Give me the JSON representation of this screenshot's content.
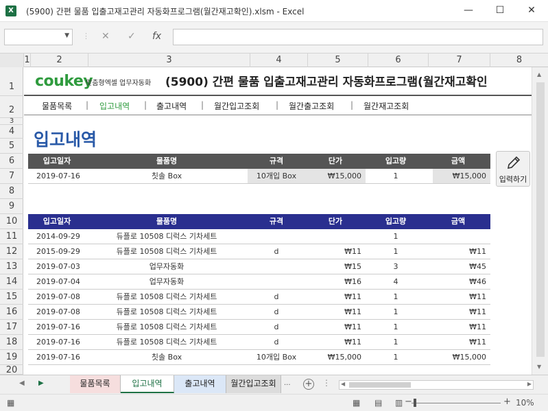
{
  "window": {
    "title": "(5900) 간편 물품 입출고재고관리 자동화프로그램(월간재고확인).xlsm - Excel",
    "app_icon": "X",
    "minimize": "—",
    "maximize": "☐",
    "close": "✕"
  },
  "formula_bar": {
    "cancel": "✕",
    "confirm": "✓",
    "fx": "fx"
  },
  "columns": [
    "1",
    "2",
    "3",
    "4",
    "5",
    "6",
    "7",
    "8"
  ],
  "rows": [
    "1",
    "2",
    "3",
    "4",
    "5",
    "6",
    "7",
    "8",
    "9",
    "10",
    "11",
    "12",
    "13",
    "14",
    "15",
    "16",
    "17",
    "18",
    "19",
    "20"
  ],
  "header": {
    "logo": "coukey",
    "logo_sub": "맞춤형엑셀 업무자동화",
    "title": "(5900) 간편 물품 입출고재고관리 자동화프로그램(월간재고확인"
  },
  "nav": [
    {
      "label": "물품목록",
      "active": false
    },
    {
      "label": "입고내역",
      "active": true
    },
    {
      "label": "출고내역",
      "active": false
    },
    {
      "label": "월간입고조회",
      "active": false
    },
    {
      "label": "월간출고조회",
      "active": false
    },
    {
      "label": "월간재고조회",
      "active": false
    }
  ],
  "nav_separator": "|",
  "section_title": "입고내역",
  "columns_table": [
    "입고일자",
    "물품명",
    "규격",
    "단가",
    "입고량",
    "금액"
  ],
  "entry_row": {
    "date": "2019-07-16",
    "name": "칫솔 Box",
    "spec": "10개입 Box",
    "price": "₩15,000",
    "qty": "1",
    "amount": "₩15,000"
  },
  "input_button": {
    "label": "입력하기",
    "icon": "pencil-icon"
  },
  "list_rows": [
    {
      "date": "2014-09-29",
      "name": "듀플로 10508 디럭스 기차세트",
      "spec": "",
      "price": "",
      "qty": "1",
      "amount": ""
    },
    {
      "date": "2015-09-29",
      "name": "듀플로 10508 디럭스 기차세트",
      "spec": "d",
      "price": "₩11",
      "qty": "1",
      "amount": "₩11"
    },
    {
      "date": "2019-07-03",
      "name": "업무자동화",
      "spec": "",
      "price": "₩15",
      "qty": "3",
      "amount": "₩45"
    },
    {
      "date": "2019-07-04",
      "name": "업무자동화",
      "spec": "",
      "price": "₩16",
      "qty": "4",
      "amount": "₩46"
    },
    {
      "date": "2019-07-08",
      "name": "듀플로 10508 디럭스 기차세트",
      "spec": "d",
      "price": "₩11",
      "qty": "1",
      "amount": "₩11"
    },
    {
      "date": "2019-07-08",
      "name": "듀플로 10508 디럭스 기차세트",
      "spec": "d",
      "price": "₩11",
      "qty": "1",
      "amount": "₩11"
    },
    {
      "date": "2019-07-16",
      "name": "듀플로 10508 디럭스 기차세트",
      "spec": "d",
      "price": "₩11",
      "qty": "1",
      "amount": "₩11"
    },
    {
      "date": "2019-07-16",
      "name": "듀플로 10508 디럭스 기차세트",
      "spec": "d",
      "price": "₩11",
      "qty": "1",
      "amount": "₩11"
    },
    {
      "date": "2019-07-16",
      "name": "칫솔 Box",
      "spec": "10개입 Box",
      "price": "₩15,000",
      "qty": "1",
      "amount": "₩15,000"
    }
  ],
  "sheet_tabs": [
    {
      "label": "물품목록",
      "active": false,
      "color": "#f6dede"
    },
    {
      "label": "입고내역",
      "active": true,
      "color": "#ffffff"
    },
    {
      "label": "출고내역",
      "active": false,
      "color": "#dbe7f7"
    },
    {
      "label": "월간입고조회",
      "active": false,
      "color": "#dcdcdc"
    }
  ],
  "tab_more": "...",
  "zoom": {
    "minus": "−",
    "plus": "+",
    "value": "10%"
  }
}
